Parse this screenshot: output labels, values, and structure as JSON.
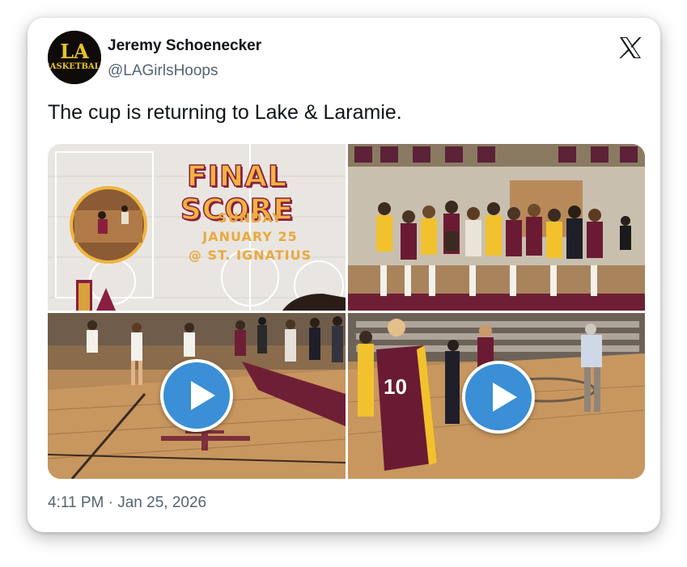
{
  "author": {
    "name": "Jeremy Schoenecker",
    "handle": "@LAGirlsHoops",
    "avatar_text": "LA BASKETBALL"
  },
  "post": {
    "text": "The cup is returning to Lake & Laramie.",
    "timestamp": "4:11 PM · Jan 25, 2026"
  },
  "media": {
    "graphic": {
      "title": "FINAL SCORE",
      "line1": "SUNDAY",
      "line2": "JANUARY 25",
      "line3": "@ ST. IGNATIUS"
    },
    "photo": {
      "type": "team-photo"
    },
    "videos": [
      {
        "type": "video"
      },
      {
        "type": "video"
      }
    ]
  },
  "icons": {
    "platform": "x-logo-icon",
    "play": "play-icon"
  },
  "colors": {
    "maroon": "#8b1e3f",
    "gold": "#f0b441",
    "play_blue": "#3a8fd6",
    "handle_gray": "#536471"
  }
}
